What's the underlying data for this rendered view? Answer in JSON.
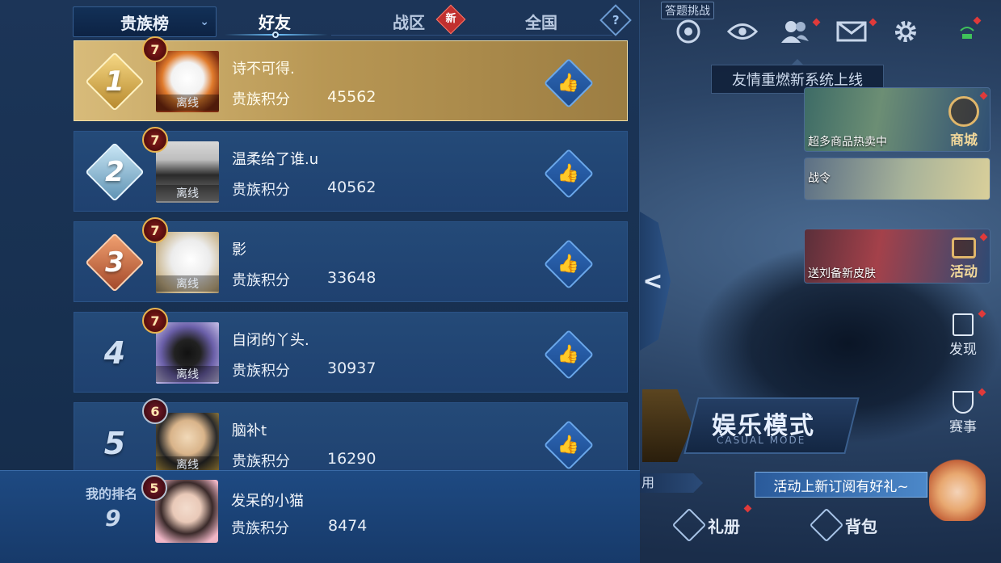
{
  "top_bar": {
    "quiz_label": "答题挑战",
    "icons": [
      "target-icon",
      "eye-icon",
      "friends-icon",
      "mail-icon",
      "gear-icon",
      "signal-icon"
    ]
  },
  "tooltip": "友情重燃新系统上线",
  "side_cards": [
    {
      "text": "超多商品热卖中",
      "action": "商城"
    },
    {
      "text": "战令",
      "action": ""
    },
    {
      "text": "送刘备新皮肤",
      "action": "活动"
    }
  ],
  "right_nav": [
    {
      "label": "发现",
      "icon": "calendar-icon"
    },
    {
      "label": "赛事",
      "icon": "trophy-icon"
    }
  ],
  "casual_mode": {
    "title": "娱乐模式",
    "subtitle": "CASUAL MODE"
  },
  "sub_tab": "用",
  "promo": "活动上新订阅有好礼~",
  "bottom_buttons": [
    {
      "label": "礼册"
    },
    {
      "label": "背包"
    }
  ],
  "leaderboard": {
    "selector": "贵族榜",
    "tabs": {
      "friends": "好友",
      "zone": "战区",
      "national": "全国",
      "new_badge": "新",
      "help": "?"
    },
    "score_label": "贵族积分",
    "offline_label": "离线",
    "entries": [
      {
        "rank": "1",
        "name": "诗不可得.",
        "score": "45562",
        "level": "7"
      },
      {
        "rank": "2",
        "name": "温柔给了谁.u",
        "score": "40562",
        "level": "7"
      },
      {
        "rank": "3",
        "name": "影",
        "score": "33648",
        "level": "7"
      },
      {
        "rank": "4",
        "name": "自闭的丫头.",
        "score": "30937",
        "level": "7"
      },
      {
        "rank": "5",
        "name": "脑补t",
        "score": "16290",
        "level": "6"
      }
    ],
    "me": {
      "label": "我的排名",
      "rank": "9",
      "name": "发呆的小猫",
      "score": "8474",
      "level": "5"
    }
  },
  "colors": {
    "accent": "#6fc4ff",
    "gold": "#d8bb7a",
    "badge_red": "#c0302f"
  }
}
